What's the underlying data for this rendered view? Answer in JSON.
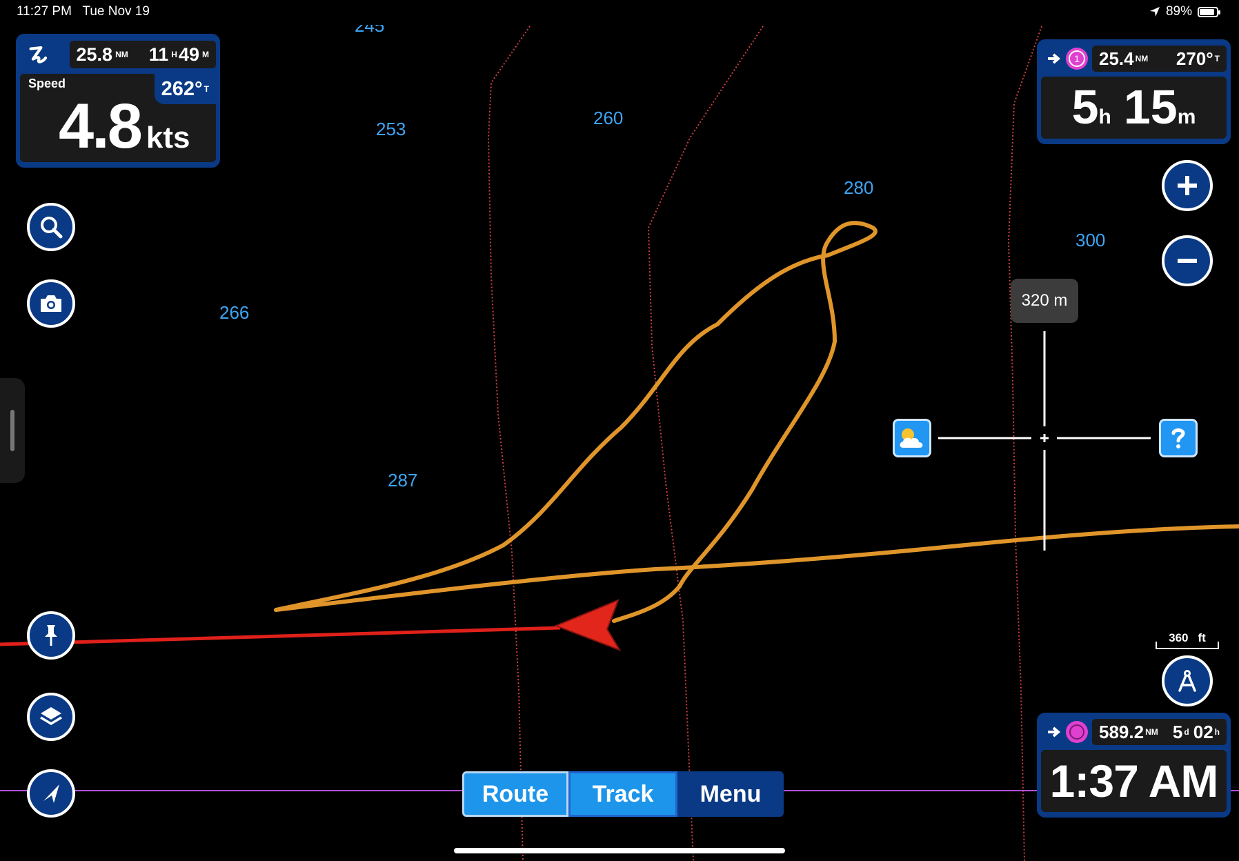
{
  "status_bar": {
    "time": "11:27 PM",
    "date": "Tue Nov 19",
    "battery": "89%",
    "battery_level": 0.89
  },
  "depths": [
    "245",
    "253",
    "260",
    "280",
    "300",
    "266",
    "287"
  ],
  "top_left_panel": {
    "log_distance": "25.8",
    "log_distance_unit": "NM",
    "elapsed_hours": "11",
    "elapsed_hours_unit": "H",
    "elapsed_minutes": "49",
    "elapsed_minutes_unit": "M",
    "speed_label": "Speed",
    "speed_value": "4.8",
    "speed_unit": "kts",
    "heading": "262°",
    "heading_unit": "T"
  },
  "top_right_panel": {
    "waypoint_number": "1",
    "distance": "25.4",
    "distance_unit": "NM",
    "bearing": "270°",
    "bearing_unit": "T",
    "eta_hours": "5",
    "eta_hours_unit": "h",
    "eta_minutes": "15",
    "eta_minutes_unit": "m"
  },
  "bottom_right_panel": {
    "distance": "589.2",
    "distance_unit": "NM",
    "duration_days": "5",
    "duration_days_unit": "d",
    "duration_hours": "02",
    "duration_hours_unit": "h",
    "arrival_time": "1:37 AM"
  },
  "cursor": {
    "distance_label": "320 m"
  },
  "scale": {
    "value": "360",
    "unit": "ft"
  },
  "bottom_bar": {
    "route": "Route",
    "track": "Track",
    "menu": "Menu"
  },
  "icons": {
    "logo": "app-logo-icon",
    "search": "search-icon",
    "camera": "camera-icon",
    "pin": "pin-icon",
    "layers": "layers-icon",
    "locate": "location-arrow-icon",
    "zoom_in": "plus-icon",
    "zoom_out": "minus-icon",
    "measure": "compass-icon",
    "weather": "weather-icon",
    "help": "question-icon",
    "boat": "boat-arrow-icon"
  },
  "colors": {
    "panel_blue": "#0a3a85",
    "button_blue": "#1c95ea",
    "depth_label": "#3da5f4",
    "track": "#e0952a",
    "heading_line": "#e0201a",
    "contour": "#d04040",
    "route_line": "#b54fd6",
    "waypoint": "#e040d0"
  }
}
